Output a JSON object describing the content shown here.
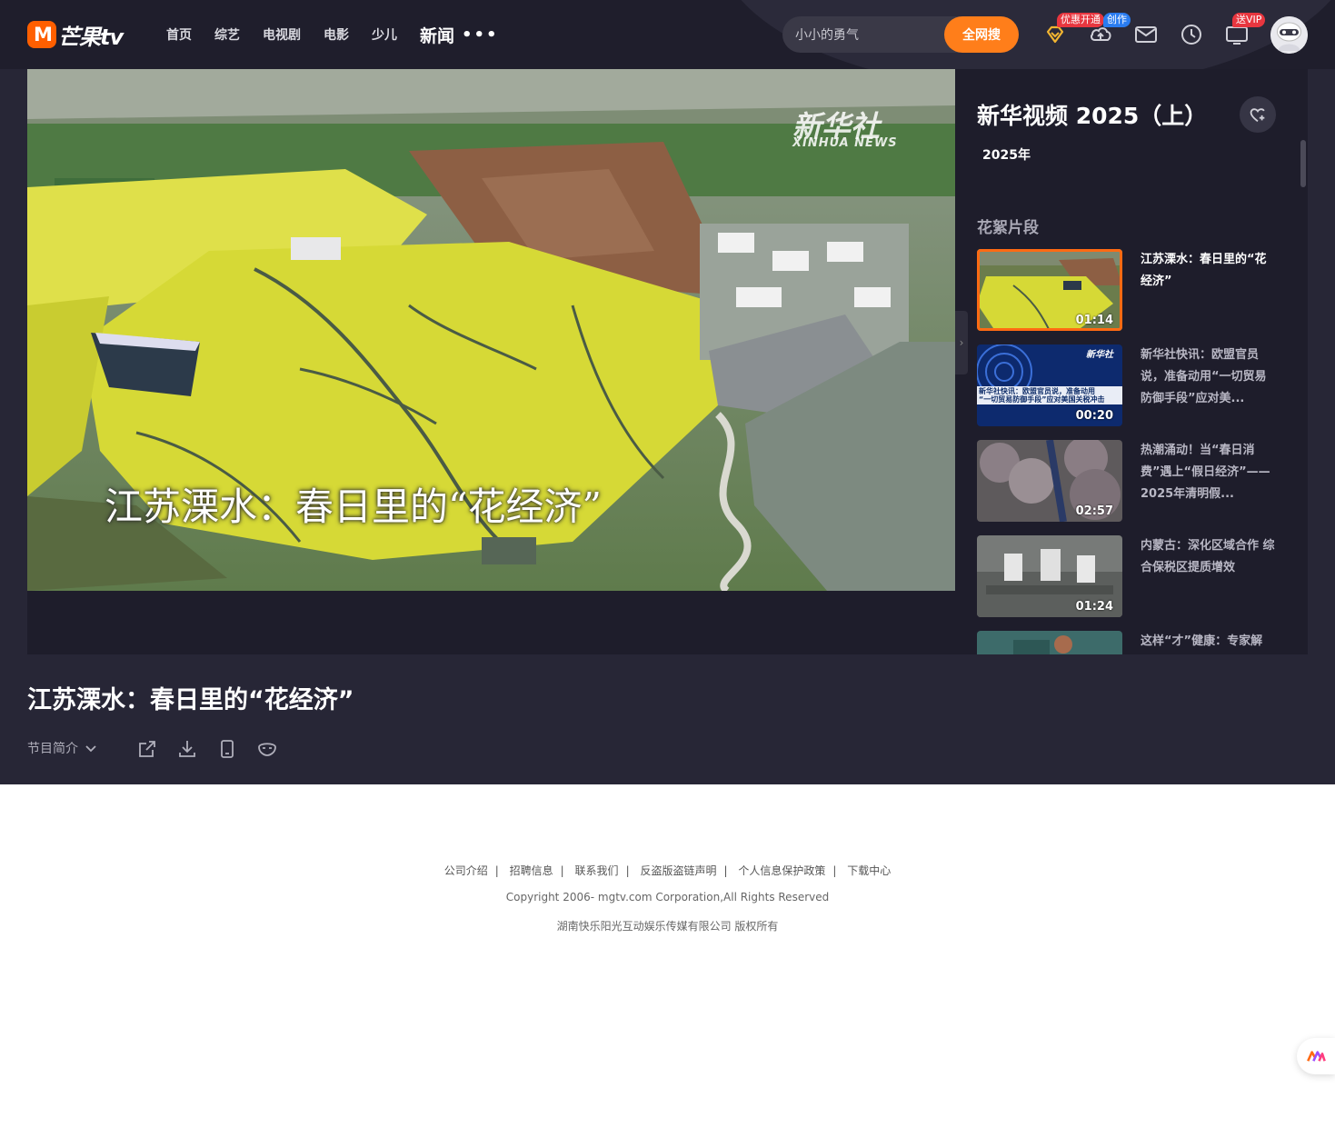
{
  "header": {
    "logo_text": "芒果tv",
    "nav": [
      "首页",
      "综艺",
      "电视剧",
      "电影",
      "少儿"
    ],
    "nav_active": "新闻",
    "nav_more": "•••",
    "search_value": "小小的勇气",
    "search_button": "全网搜",
    "badges": {
      "vip_offer": "优惠开通",
      "create": "创作",
      "send_vip": "送VIP"
    }
  },
  "player": {
    "subtitle": "江苏溧水：春日里的“花经济”",
    "watermark_cn": "新华社",
    "watermark_en": "XINHUA NEWS"
  },
  "sidebar": {
    "title": "新华视频 2025（上）",
    "year": "2025年",
    "section": "花絮片段",
    "clips": [
      {
        "title": "江苏溧水：春日里的“花经济”",
        "duration": "01:14"
      },
      {
        "title": "新华社快讯：欧盟官员说，准备动用“一切贸易防御手段”应对美...",
        "duration": "00:20"
      },
      {
        "title": "热潮涌动！当“春日消费”遇上“假日经济”——2025年清明假...",
        "duration": "02:57"
      },
      {
        "title": "内蒙古：深化区域合作 综合保税区提质增效",
        "duration": "01:24"
      },
      {
        "title": "这样“才”健康：专家解",
        "duration": ""
      }
    ],
    "clip2_caption_line1": "新华社快讯：欧盟官员说，准备动用",
    "clip2_caption_line2": "“一切贸易防御手段”应对美国关税冲击",
    "clip2_logo": "新华社"
  },
  "main": {
    "title": "江苏溧水：春日里的“花经济”",
    "intro_label": "节目简介"
  },
  "footer": {
    "links": [
      "公司介绍",
      "招聘信息",
      "联系我们",
      "反盗版盗链声明",
      "个人信息保护政策",
      "下载中心"
    ],
    "separator": "|",
    "copyright": "Copyright 2006- mgtv.com Corporation,All Rights Reserved",
    "company": "湖南快乐阳光互动娱乐传媒有限公司 版权所有"
  },
  "colors": {
    "accent": "#ff7e1a",
    "bg_dark": "#272636",
    "panel": "#1e1d2b"
  }
}
